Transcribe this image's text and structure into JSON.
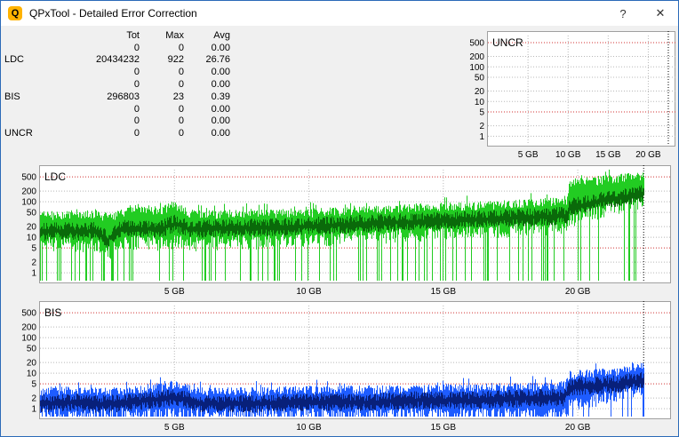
{
  "window": {
    "title": "QPxTool - Detailed Error Correction",
    "help_label": "?",
    "close_label": "✕",
    "icon_letter": "Q"
  },
  "stats": {
    "headers": [
      "",
      "Tot",
      "Max",
      "Avg"
    ],
    "rows": [
      {
        "label": "",
        "tot": "0",
        "max": "0",
        "avg": "0.00"
      },
      {
        "label": "LDC",
        "tot": "20434232",
        "max": "922",
        "avg": "26.76"
      },
      {
        "label": "",
        "tot": "0",
        "max": "0",
        "avg": "0.00"
      },
      {
        "label": "",
        "tot": "0",
        "max": "0",
        "avg": "0.00"
      },
      {
        "label": "BIS",
        "tot": "296803",
        "max": "23",
        "avg": "0.39"
      },
      {
        "label": "",
        "tot": "0",
        "max": "0",
        "avg": "0.00"
      },
      {
        "label": "",
        "tot": "0",
        "max": "0",
        "avg": "0.00"
      },
      {
        "label": "UNCR",
        "tot": "0",
        "max": "0",
        "avg": "0.00"
      }
    ]
  },
  "colors": {
    "ldc_light": "#22cc22",
    "ldc_dark": "#0a6a0a",
    "bis_light": "#1e5cff",
    "bis_dark": "#08207a",
    "grid_red": "#d03030",
    "grid_gray": "#b8b8b8"
  },
  "chart_data": [
    {
      "type": "area",
      "title": "UNCR",
      "scale": "log",
      "y_ticks": [
        1,
        2,
        5,
        10,
        20,
        50,
        100,
        200,
        500
      ],
      "x_ticks": [
        "5 GB",
        "10 GB",
        "15 GB",
        "20 GB"
      ],
      "x_tick_values": [
        5,
        10,
        15,
        20
      ],
      "xlim": [
        0,
        23.5
      ],
      "end_marker": 22.5,
      "series": [
        {
          "values": []
        }
      ]
    },
    {
      "type": "area",
      "title": "LDC",
      "scale": "log",
      "y_ticks": [
        1,
        2,
        5,
        10,
        20,
        50,
        100,
        200,
        500
      ],
      "x_ticks": [
        "5 GB",
        "10 GB",
        "15 GB",
        "20 GB"
      ],
      "x_tick_values": [
        5,
        10,
        15,
        20
      ],
      "xlim": [
        0,
        23.5
      ],
      "end_marker": 22.45,
      "x": [
        0.0,
        0.5,
        1.0,
        1.5,
        2.0,
        2.5,
        3.0,
        3.5,
        4.0,
        4.5,
        5.0,
        5.5,
        6.0,
        7.0,
        8.0,
        9.0,
        10.0,
        11.0,
        12.0,
        13.0,
        14.0,
        15.0,
        16.0,
        17.0,
        18.0,
        19.0,
        19.6,
        19.7,
        20.0,
        20.5,
        21.0,
        21.5,
        22.0,
        22.4
      ],
      "peak": [
        55,
        55,
        60,
        55,
        60,
        50,
        60,
        90,
        80,
        75,
        110,
        60,
        60,
        60,
        60,
        65,
        65,
        70,
        75,
        80,
        90,
        95,
        100,
        110,
        120,
        130,
        150,
        450,
        480,
        500,
        560,
        600,
        650,
        700
      ],
      "avg": [
        20,
        22,
        22,
        20,
        22,
        12,
        25,
        25,
        25,
        25,
        35,
        25,
        25,
        26,
        27,
        28,
        30,
        32,
        35,
        37,
        40,
        42,
        45,
        48,
        52,
        55,
        60,
        100,
        110,
        130,
        160,
        180,
        220,
        250
      ],
      "low": [
        8,
        8,
        8,
        6,
        8,
        4,
        8,
        9,
        9,
        8,
        9,
        8,
        8,
        9,
        9,
        10,
        10,
        11,
        12,
        13,
        14,
        15,
        16,
        18,
        20,
        22,
        24,
        35,
        40,
        55,
        70,
        90,
        110,
        130
      ]
    },
    {
      "type": "area",
      "title": "BIS",
      "scale": "log",
      "y_ticks": [
        1,
        2,
        5,
        10,
        20,
        50,
        100,
        200,
        500
      ],
      "x_ticks": [
        "5 GB",
        "10 GB",
        "15 GB",
        "20 GB"
      ],
      "x_tick_values": [
        5,
        10,
        15,
        20
      ],
      "xlim": [
        0,
        23.5
      ],
      "end_marker": 22.45,
      "x": [
        0.0,
        1.0,
        2.0,
        3.0,
        4.0,
        5.0,
        6.0,
        8.0,
        10.0,
        12.0,
        14.0,
        16.0,
        18.0,
        19.5,
        19.7,
        20.5,
        21.5,
        22.4
      ],
      "peak": [
        4,
        4.5,
        4,
        4,
        5,
        6,
        4,
        4,
        4.5,
        4.5,
        5,
        5,
        5.5,
        6,
        12,
        13,
        15,
        22
      ],
      "avg": [
        2,
        2.2,
        2,
        2,
        2.5,
        3,
        2,
        2,
        2.2,
        2.2,
        2.5,
        2.5,
        2.8,
        3,
        6,
        6.5,
        7,
        9
      ],
      "low": [
        0.8,
        0.8,
        0.8,
        0.8,
        0.8,
        0.8,
        0.8,
        0.8,
        0.8,
        0.8,
        0.8,
        0.8,
        0.8,
        0.8,
        1.5,
        2,
        3,
        4
      ]
    }
  ]
}
